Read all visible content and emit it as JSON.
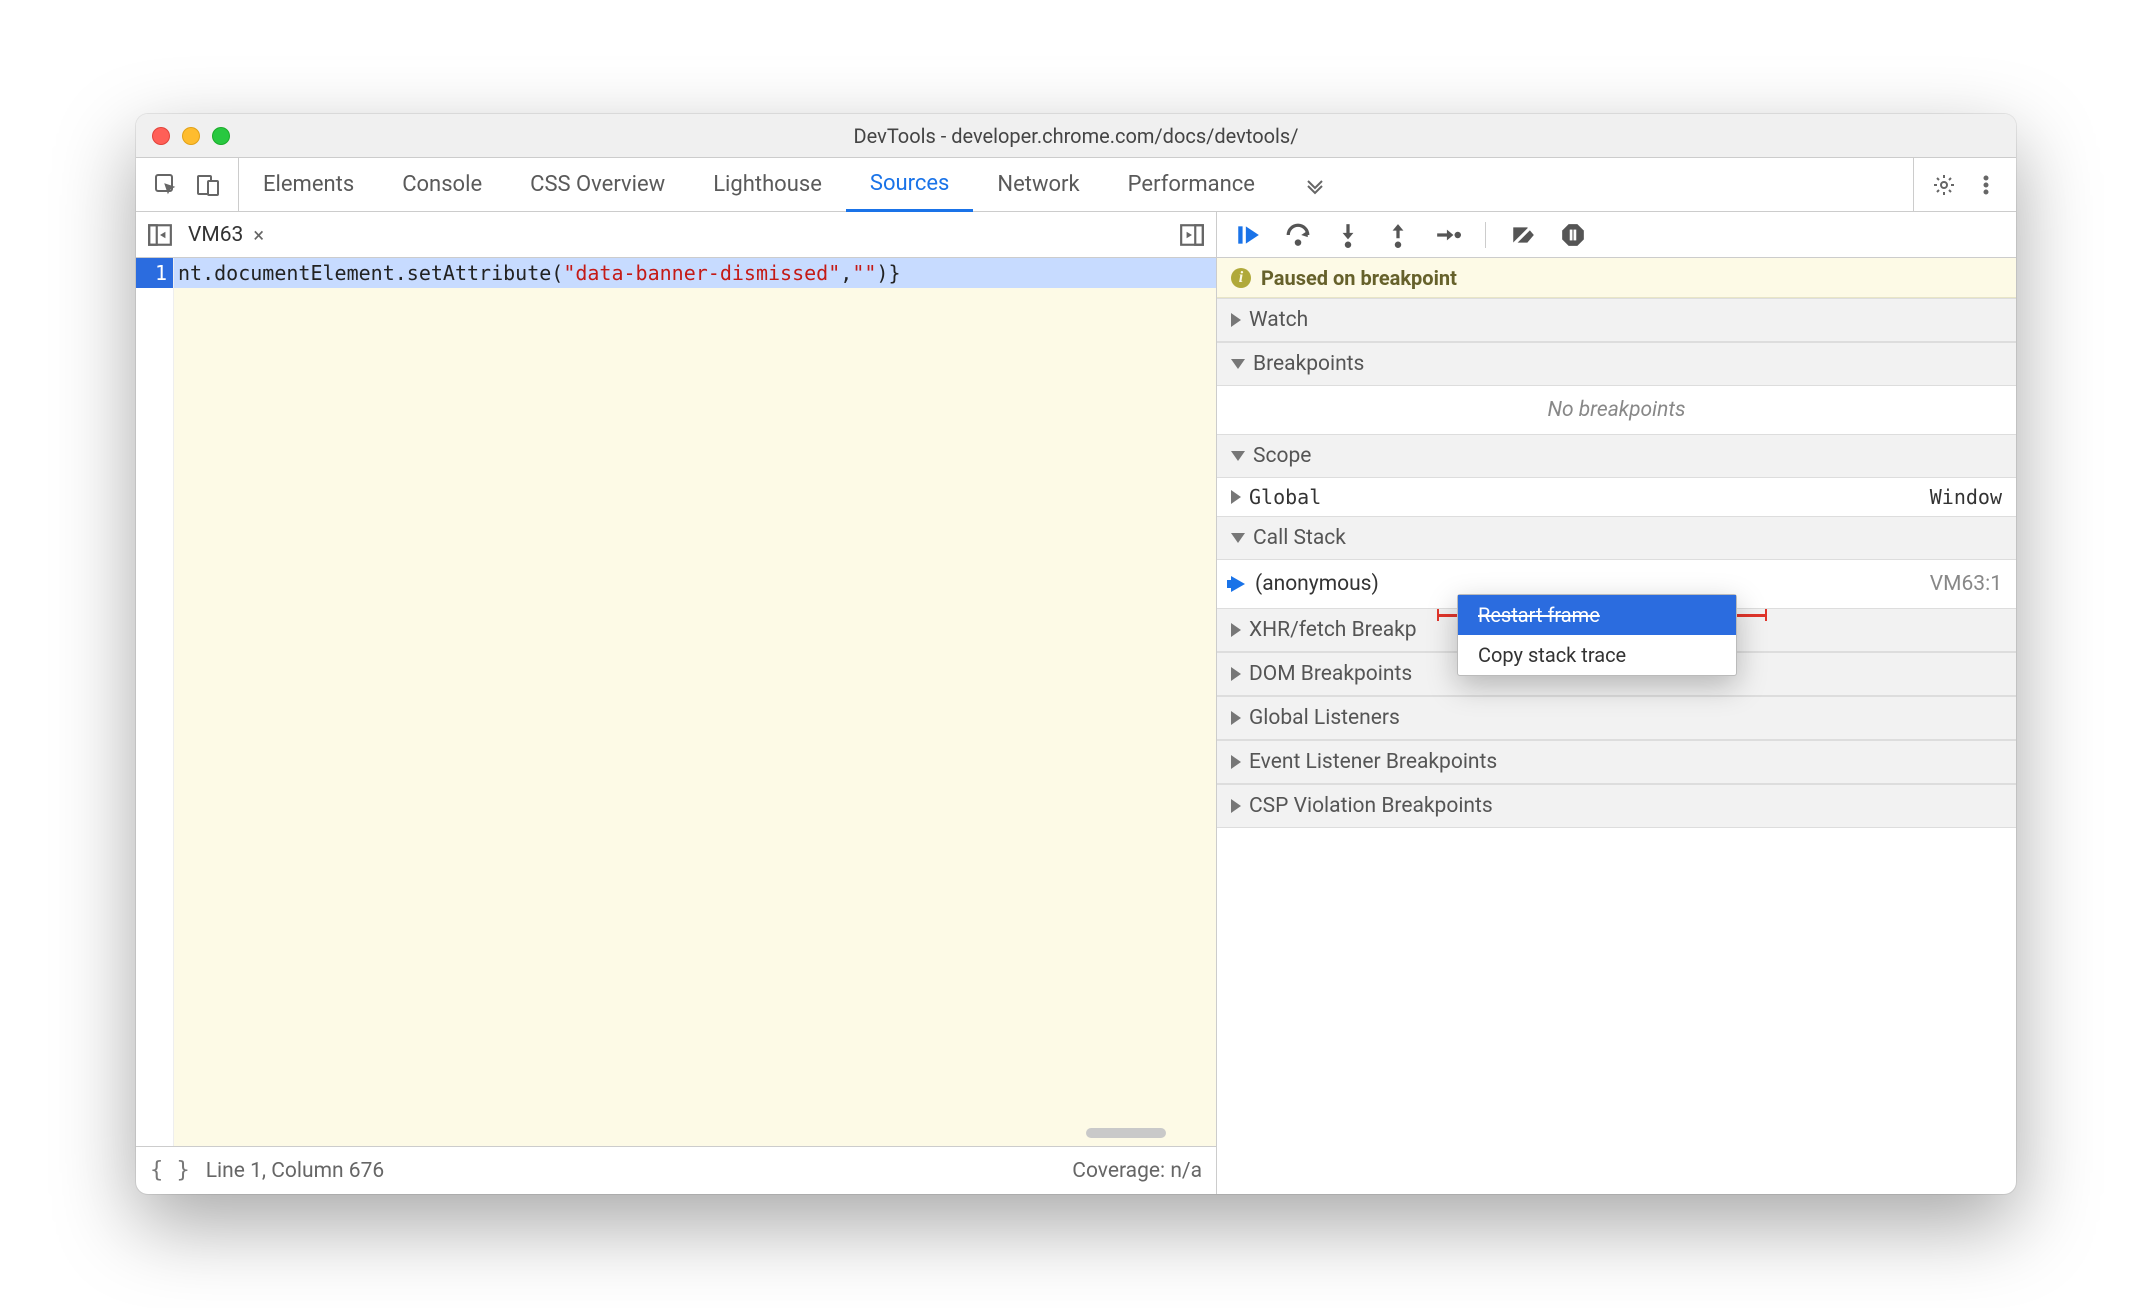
{
  "window": {
    "title": "DevTools - developer.chrome.com/docs/devtools/"
  },
  "topTabs": {
    "items": [
      {
        "label": "Elements"
      },
      {
        "label": "Console"
      },
      {
        "label": "CSS Overview"
      },
      {
        "label": "Lighthouse"
      },
      {
        "label": "Sources"
      },
      {
        "label": "Network"
      },
      {
        "label": "Performance"
      }
    ],
    "activeIndex": 4
  },
  "editor": {
    "fileTab": "VM63",
    "lineNumber": "1",
    "code": {
      "pre": "nt.documentElement.setAttribute(",
      "str1": "\"data-banner-dismissed\"",
      "mid": ",",
      "str2": "\"\"",
      "post": ")}"
    },
    "status": {
      "cursor": "Line 1, Column 676",
      "coverage": "Coverage: n/a"
    }
  },
  "debug": {
    "pauseBanner": "Paused on breakpoint",
    "sections": {
      "watch": "Watch",
      "breakpoints": "Breakpoints",
      "noBreakpoints": "No breakpoints",
      "scope": "Scope",
      "scopeGlobal": "Global",
      "scopeGlobalValue": "Window",
      "callStack": "Call Stack",
      "callStackFrame": "(anonymous)",
      "callStackLoc": "VM63:1",
      "xhr": "XHR/fetch Breakp",
      "dom": "DOM Breakpoints",
      "glob": "Global Listeners",
      "evt": "Event Listener Breakpoints",
      "csp": "CSP Violation Breakpoints"
    },
    "contextMenu": {
      "restart": "Restart frame",
      "copy": "Copy stack trace"
    }
  }
}
